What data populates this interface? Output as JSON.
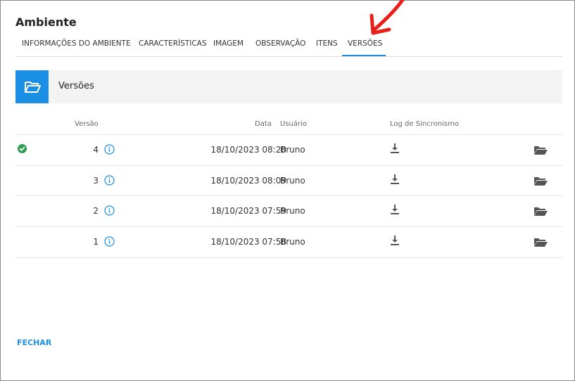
{
  "dialog": {
    "title": "Ambiente",
    "close_label": "FECHAR"
  },
  "tabs": [
    {
      "label": "INFORMAÇÕES DO AMBIENTE"
    },
    {
      "label": "CARACTERÍSTICAS"
    },
    {
      "label": "IMAGEM"
    },
    {
      "label": "OBSERVAÇÃO"
    },
    {
      "label": "ITENS"
    },
    {
      "label": "VERSÕES",
      "active": true
    }
  ],
  "section": {
    "title": "Versões",
    "icon": "folder-open-icon"
  },
  "table": {
    "headers": {
      "versao": "Versão",
      "data": "Data",
      "usuario": "Usuário",
      "log": "Log de Sincronismo"
    },
    "rows": [
      {
        "versao": "4",
        "data": "18/10/2023 08:20",
        "usuario": "Bruno",
        "current": true
      },
      {
        "versao": "3",
        "data": "18/10/2023 08:09",
        "usuario": "Bruno",
        "current": false
      },
      {
        "versao": "2",
        "data": "18/10/2023 07:59",
        "usuario": "Bruno",
        "current": false
      },
      {
        "versao": "1",
        "data": "18/10/2023 07:58",
        "usuario": "Bruno",
        "current": false
      }
    ]
  },
  "colors": {
    "accent": "#1a8fe3",
    "success": "#2e9e4f",
    "annotation_arrow": "#e8201a"
  }
}
